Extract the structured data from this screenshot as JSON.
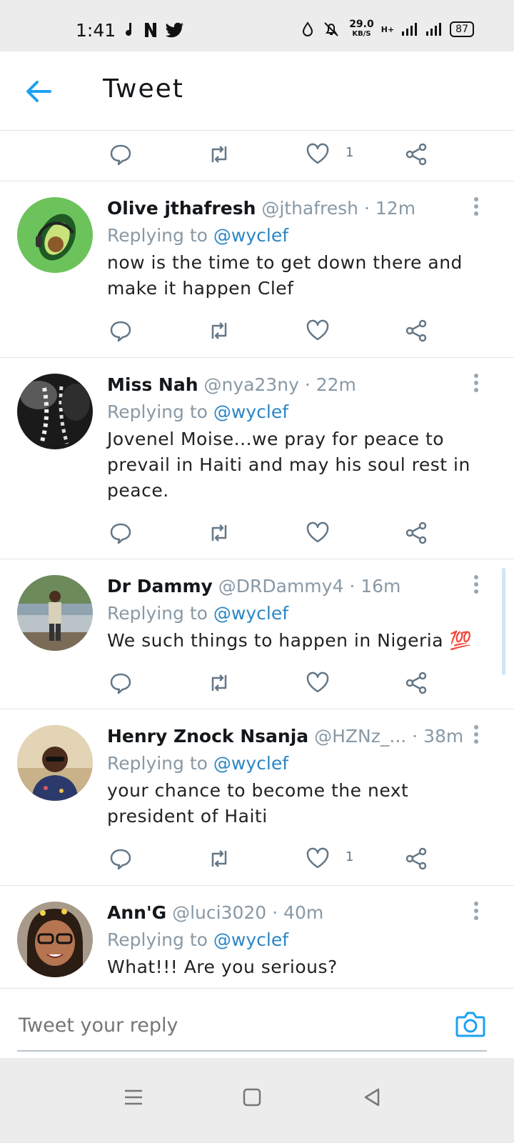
{
  "status_bar": {
    "time": "1:41",
    "speed_value": "29.0",
    "speed_unit": "KB/S",
    "network": "H+",
    "battery": "87"
  },
  "header": {
    "title": "Tweet",
    "back_icon": "arrow-left-icon"
  },
  "top_actions": {
    "like_count": "1"
  },
  "tweets": [
    {
      "name": "Olive jthafresh",
      "handle": "@jthafresh",
      "time": "12m",
      "replying_prefix": "Replying to",
      "replying_to": "@wyclef",
      "text": "now is the time to get down there and make it happen Clef",
      "like_count": ""
    },
    {
      "name": "Miss Nah",
      "handle": "@nya23ny",
      "time": "22m",
      "replying_prefix": "Replying to",
      "replying_to": "@wyclef",
      "text": "Jovenel Moise...we pray for peace to prevail in Haiti and may his soul rest in peace.",
      "like_count": ""
    },
    {
      "name": "Dr Dammy",
      "handle": "@DRDammy4",
      "time": "16m",
      "replying_prefix": "Replying to",
      "replying_to": "@wyclef",
      "text": "We such things to happen in Nigeria 💯",
      "like_count": ""
    },
    {
      "name": "Henry Znock Nsanja",
      "handle": "@HZNz_...",
      "time": "38m",
      "replying_prefix": "Replying to",
      "replying_to": "@wyclef",
      "text": "your chance to become the next president of Haiti",
      "like_count": "1"
    },
    {
      "name": "Ann'G",
      "handle": "@luci3020",
      "time": "40m",
      "replying_prefix": "Replying to",
      "replying_to": "@wyclef",
      "text": "What!!! Are you serious?",
      "like_count": ""
    }
  ],
  "reply_bar": {
    "placeholder": "Tweet your reply",
    "camera_icon": "camera-icon"
  },
  "colors": {
    "accent": "#1da1f2",
    "mention": "#2b86c5",
    "muted": "#8899a6",
    "icon": "#657786"
  }
}
